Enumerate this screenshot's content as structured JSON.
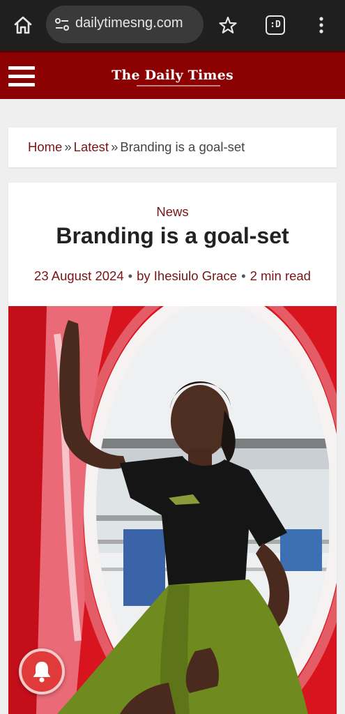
{
  "browser": {
    "url": "dailytimesng.com",
    "icons": [
      "home-icon",
      "site-settings-icon",
      "bookmark-star-icon",
      "extension-icon",
      "more-menu-icon"
    ],
    "extension_label": ":D"
  },
  "site": {
    "logo_text": "The Daily Times",
    "header_color": "#8b0000"
  },
  "breadcrumb": {
    "home": "Home",
    "sep1": "»",
    "latest": "Latest",
    "sep2": "»",
    "current": "Branding is a goal-set"
  },
  "article": {
    "category": "News",
    "title": "Branding is a goal-set",
    "date": "23 August 2024",
    "author": "by Ihesiulo Grace",
    "read_time": "2 min read",
    "dot": "•"
  },
  "colors": {
    "accent": "#7a1414",
    "bell": "#e03a3a"
  }
}
